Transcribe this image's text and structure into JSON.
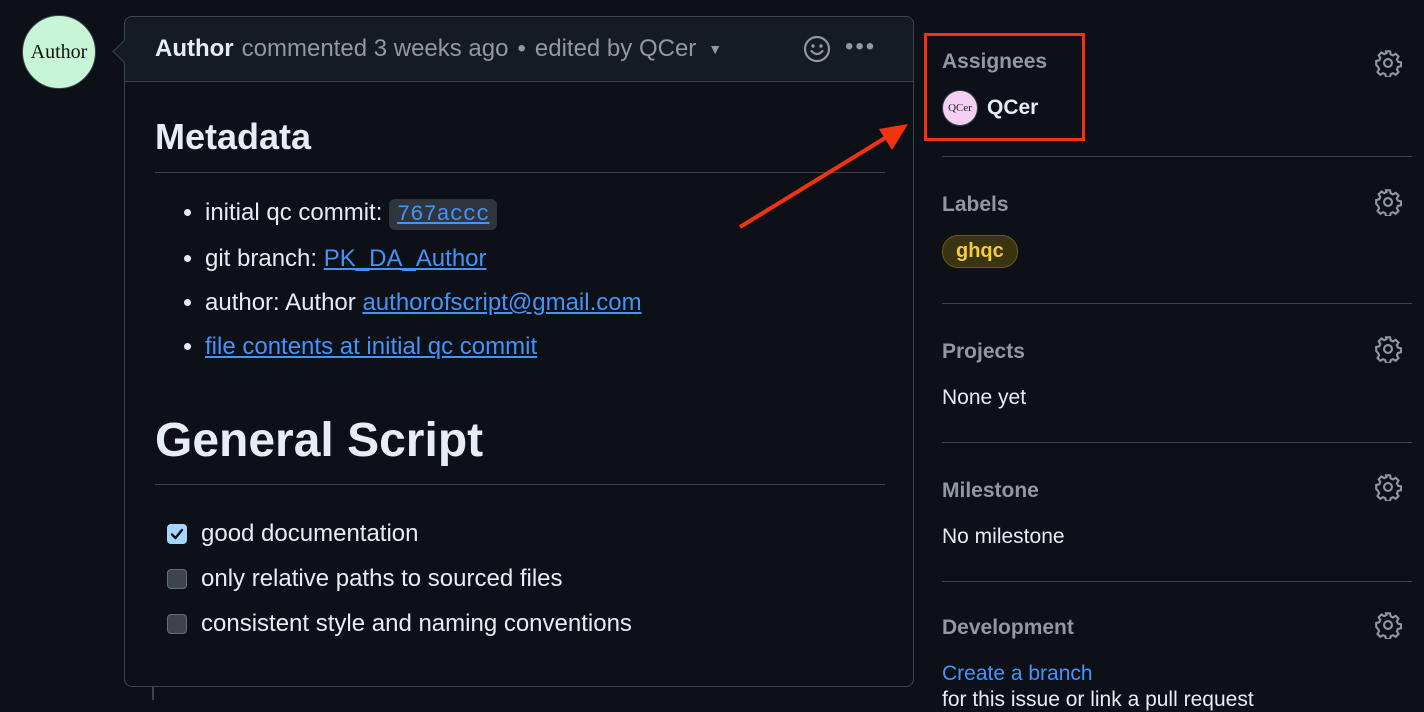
{
  "comment": {
    "avatar_text": "Author",
    "author": "Author",
    "action": "commented 3 weeks ago",
    "separator": "•",
    "edited_by": "edited by QCer",
    "metadata_heading": "Metadata",
    "metadata_items": [
      {
        "label": "initial qc commit:",
        "link": "767accc"
      },
      {
        "label": "git branch:",
        "link": "PK_DA_Author"
      },
      {
        "label": "author: Author",
        "link": "authorofscript@gmail.com"
      },
      {
        "label": "",
        "link": "file contents at initial qc commit"
      }
    ],
    "section_heading": "General Script",
    "checklist": [
      {
        "text": "good documentation",
        "checked": true
      },
      {
        "text": "only relative paths to sourced files",
        "checked": false
      },
      {
        "text": "consistent style and naming conventions",
        "checked": false
      }
    ]
  },
  "sidebar": {
    "assignees": {
      "title": "Assignees",
      "avatar_text": "QCer",
      "name": "QCer"
    },
    "labels": {
      "title": "Labels",
      "label": "ghqc",
      "label_color": "#f2cc3a"
    },
    "projects": {
      "title": "Projects",
      "value": "None yet"
    },
    "milestone": {
      "title": "Milestone",
      "value": "No milestone"
    },
    "development": {
      "title": "Development",
      "link": "Create a branch",
      "subtext": "for this issue or link a pull request"
    }
  },
  "annotation": {
    "color": "#f2330f"
  }
}
